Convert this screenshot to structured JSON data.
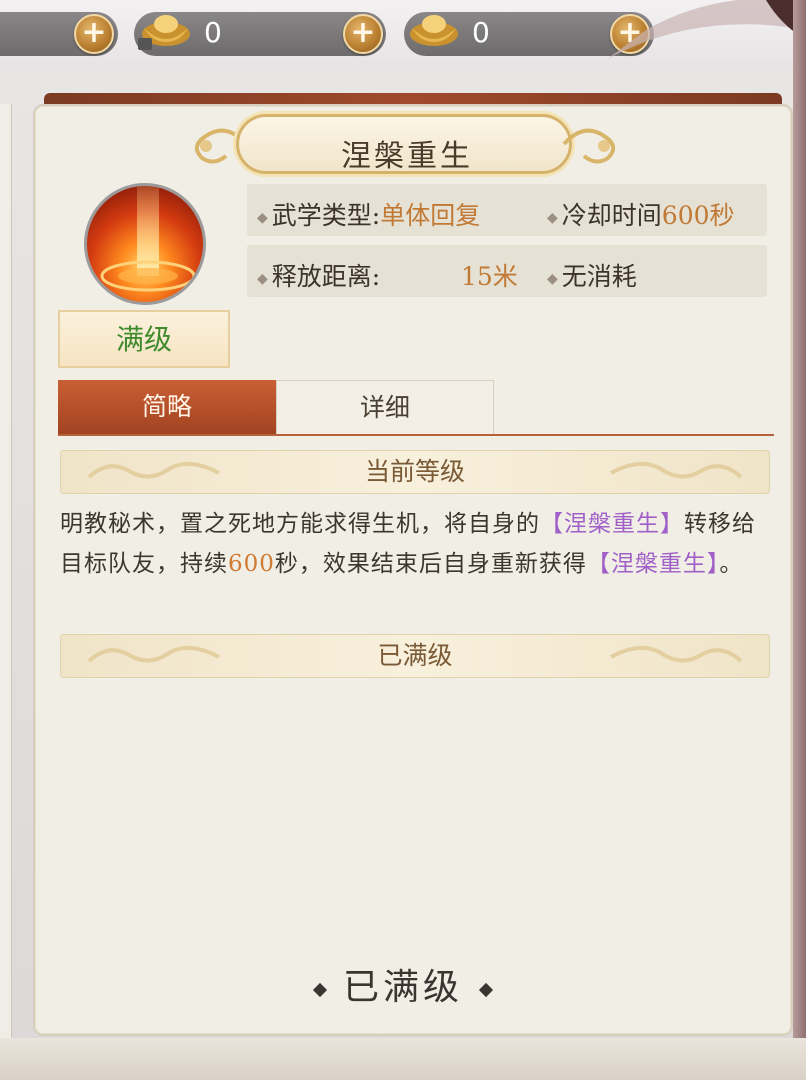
{
  "currency": [
    {
      "icon": "gold-ingot-bound-icon",
      "value": "0"
    },
    {
      "icon": "gold-ingot-icon",
      "value": "0"
    }
  ],
  "skill": {
    "name": "涅槃重生",
    "icon": "fire-pillar-icon",
    "level_status": "满级"
  },
  "stats": {
    "type_label": "武学类型:",
    "type_value": "单体回复",
    "cooldown_label": "冷却时间",
    "cooldown_value": "600秒",
    "range_label": "释放距离:",
    "range_value": "15米",
    "cost_label": "无消耗"
  },
  "tabs": [
    {
      "label": "简略",
      "active": true
    },
    {
      "label": "详细",
      "active": false
    }
  ],
  "sections": {
    "current_level": "当前等级",
    "next_level": "已满级"
  },
  "description": {
    "part1": "明教秘术，置之死地方能求得生机，将自身的",
    "hl1": "【涅槃重生】",
    "part2": "转移给目标队友，持续",
    "num": "600",
    "part3": "秒，效果结束后自身重新获得",
    "hl2": "【涅槃重生】",
    "part4": "。"
  },
  "bottom_status": "已满级",
  "colors": {
    "accent_tab": "#c95f34",
    "highlight_purple": "#a060c8",
    "value_orange": "#c07a35",
    "level_green": "#3f8a2c"
  }
}
